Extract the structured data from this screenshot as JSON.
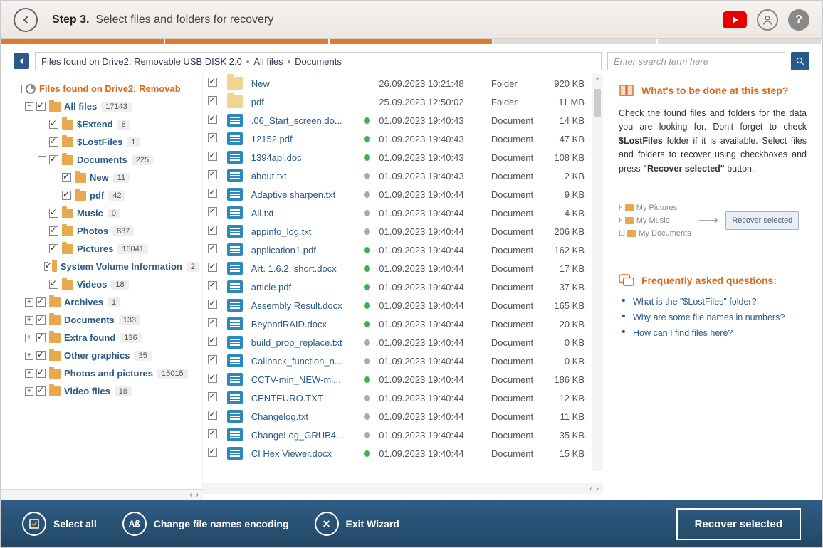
{
  "header": {
    "step": "Step 3.",
    "title": "Select files and folders for recovery"
  },
  "breadcrumb": {
    "root": "Files found on Drive2: Removable USB DISK 2.0",
    "p1": "All files",
    "p2": "Documents",
    "search_placeholder": "Enter search term here"
  },
  "tree": {
    "root": "Files found on Drive2: Removab",
    "items": [
      {
        "label": "All files",
        "count": "17143",
        "lvl": 1,
        "exp": "−"
      },
      {
        "label": "$Extend",
        "count": "8",
        "lvl": 2
      },
      {
        "label": "$LostFiles",
        "count": "1",
        "lvl": 2
      },
      {
        "label": "Documents",
        "count": "225",
        "lvl": 2,
        "exp": "−"
      },
      {
        "label": "New",
        "count": "11",
        "lvl": 3
      },
      {
        "label": "pdf",
        "count": "42",
        "lvl": 3
      },
      {
        "label": "Music",
        "count": "0",
        "lvl": 2
      },
      {
        "label": "Photos",
        "count": "837",
        "lvl": 2
      },
      {
        "label": "Pictures",
        "count": "16041",
        "lvl": 2
      },
      {
        "label": "System Volume Information",
        "count": "2",
        "lvl": 2
      },
      {
        "label": "Videos",
        "count": "18",
        "lvl": 2
      },
      {
        "label": "Archives",
        "count": "1",
        "lvl": 1,
        "exp": "+"
      },
      {
        "label": "Documents",
        "count": "133",
        "lvl": 1,
        "exp": "+"
      },
      {
        "label": "Extra found",
        "count": "136",
        "lvl": 1,
        "exp": "+"
      },
      {
        "label": "Other graphics",
        "count": "35",
        "lvl": 1,
        "exp": "+"
      },
      {
        "label": "Photos and pictures",
        "count": "15015",
        "lvl": 1,
        "exp": "+"
      },
      {
        "label": "Video files",
        "count": "18",
        "lvl": 1,
        "exp": "+"
      }
    ]
  },
  "files": [
    {
      "name": "New",
      "date": "26.09.2023 10:21:48",
      "type": "Folder",
      "size": "920 KB",
      "icon": "folder",
      "dot": ""
    },
    {
      "name": "pdf",
      "date": "25.09.2023 12:50:02",
      "type": "Folder",
      "size": "11 MB",
      "icon": "folder",
      "dot": ""
    },
    {
      "name": ".06_Start_screen.do...",
      "date": "01.09.2023 19:40:43",
      "type": "Document",
      "size": "14 KB",
      "icon": "doc",
      "dot": "g"
    },
    {
      "name": "12152.pdf",
      "date": "01.09.2023 19:40:43",
      "type": "Document",
      "size": "47 KB",
      "icon": "doc",
      "dot": "g"
    },
    {
      "name": "1394api.doc",
      "date": "01.09.2023 19:40:43",
      "type": "Document",
      "size": "108 KB",
      "icon": "doc",
      "dot": "g"
    },
    {
      "name": "about.txt",
      "date": "01.09.2023 19:40:43",
      "type": "Document",
      "size": "2 KB",
      "icon": "doc",
      "dot": "gr"
    },
    {
      "name": "Adaptive sharpen.txt",
      "date": "01.09.2023 19:40:44",
      "type": "Document",
      "size": "9 KB",
      "icon": "doc",
      "dot": "gr"
    },
    {
      "name": "All.txt",
      "date": "01.09.2023 19:40:44",
      "type": "Document",
      "size": "4 KB",
      "icon": "doc",
      "dot": "gr"
    },
    {
      "name": "appinfo_log.txt",
      "date": "01.09.2023 19:40:44",
      "type": "Document",
      "size": "206 KB",
      "icon": "doc",
      "dot": "gr"
    },
    {
      "name": "application1.pdf",
      "date": "01.09.2023 19:40:44",
      "type": "Document",
      "size": "162 KB",
      "icon": "doc",
      "dot": "g"
    },
    {
      "name": "Art. 1.6.2. short.docx",
      "date": "01.09.2023 19:40:44",
      "type": "Document",
      "size": "17 KB",
      "icon": "doc",
      "dot": "g"
    },
    {
      "name": "article.pdf",
      "date": "01.09.2023 19:40:44",
      "type": "Document",
      "size": "37 KB",
      "icon": "doc",
      "dot": "g"
    },
    {
      "name": "Assembly Result.docx",
      "date": "01.09.2023 19:40:44",
      "type": "Document",
      "size": "165 KB",
      "icon": "doc",
      "dot": "g"
    },
    {
      "name": "BeyondRAID.docx",
      "date": "01.09.2023 19:40:44",
      "type": "Document",
      "size": "20 KB",
      "icon": "doc",
      "dot": "g"
    },
    {
      "name": "build_prop_replace.txt",
      "date": "01.09.2023 19:40:44",
      "type": "Document",
      "size": "0 KB",
      "icon": "doc",
      "dot": "gr"
    },
    {
      "name": "Callback_function_n...",
      "date": "01.09.2023 19:40:44",
      "type": "Document",
      "size": "0 KB",
      "icon": "doc",
      "dot": "gr"
    },
    {
      "name": "CCTV-min_NEW-mi...",
      "date": "01.09.2023 19:40:44",
      "type": "Document",
      "size": "186 KB",
      "icon": "doc",
      "dot": "g"
    },
    {
      "name": "CENTEURO.TXT",
      "date": "01.09.2023 19:40:44",
      "type": "Document",
      "size": "12 KB",
      "icon": "doc",
      "dot": "gr"
    },
    {
      "name": "Changelog.txt",
      "date": "01.09.2023 19:40:44",
      "type": "Document",
      "size": "11 KB",
      "icon": "doc",
      "dot": "gr"
    },
    {
      "name": "ChangeLog_GRUB4...",
      "date": "01.09.2023 19:40:44",
      "type": "Document",
      "size": "35 KB",
      "icon": "doc",
      "dot": "gr"
    },
    {
      "name": "CI Hex Viewer.docx",
      "date": "01.09.2023 19:40:44",
      "type": "Document",
      "size": "15 KB",
      "icon": "doc",
      "dot": "g"
    }
  ],
  "side": {
    "title": "What's to be done at this step?",
    "text1": "Check the found files and folders for the data you are looking for. Don't forget to check ",
    "bold1": "$LostFiles",
    "text2": " folder if it is available. Select files and folders to recover using checkboxes and press ",
    "bold2": "\"Recover selected\"",
    "text3": " button.",
    "illus": {
      "i1": "My Pictures",
      "i2": "My Music",
      "i3": "My Documents",
      "btn": "Recover selected"
    },
    "faq_title": "Frequently asked questions:",
    "faqs": [
      "What is the \"$LostFiles\" folder?",
      "Why are some file names in numbers?",
      "How can I find files here?"
    ]
  },
  "footer": {
    "selectall": "Select all",
    "encoding": "Change file names encoding",
    "exit": "Exit Wizard",
    "recover": "Recover selected"
  }
}
